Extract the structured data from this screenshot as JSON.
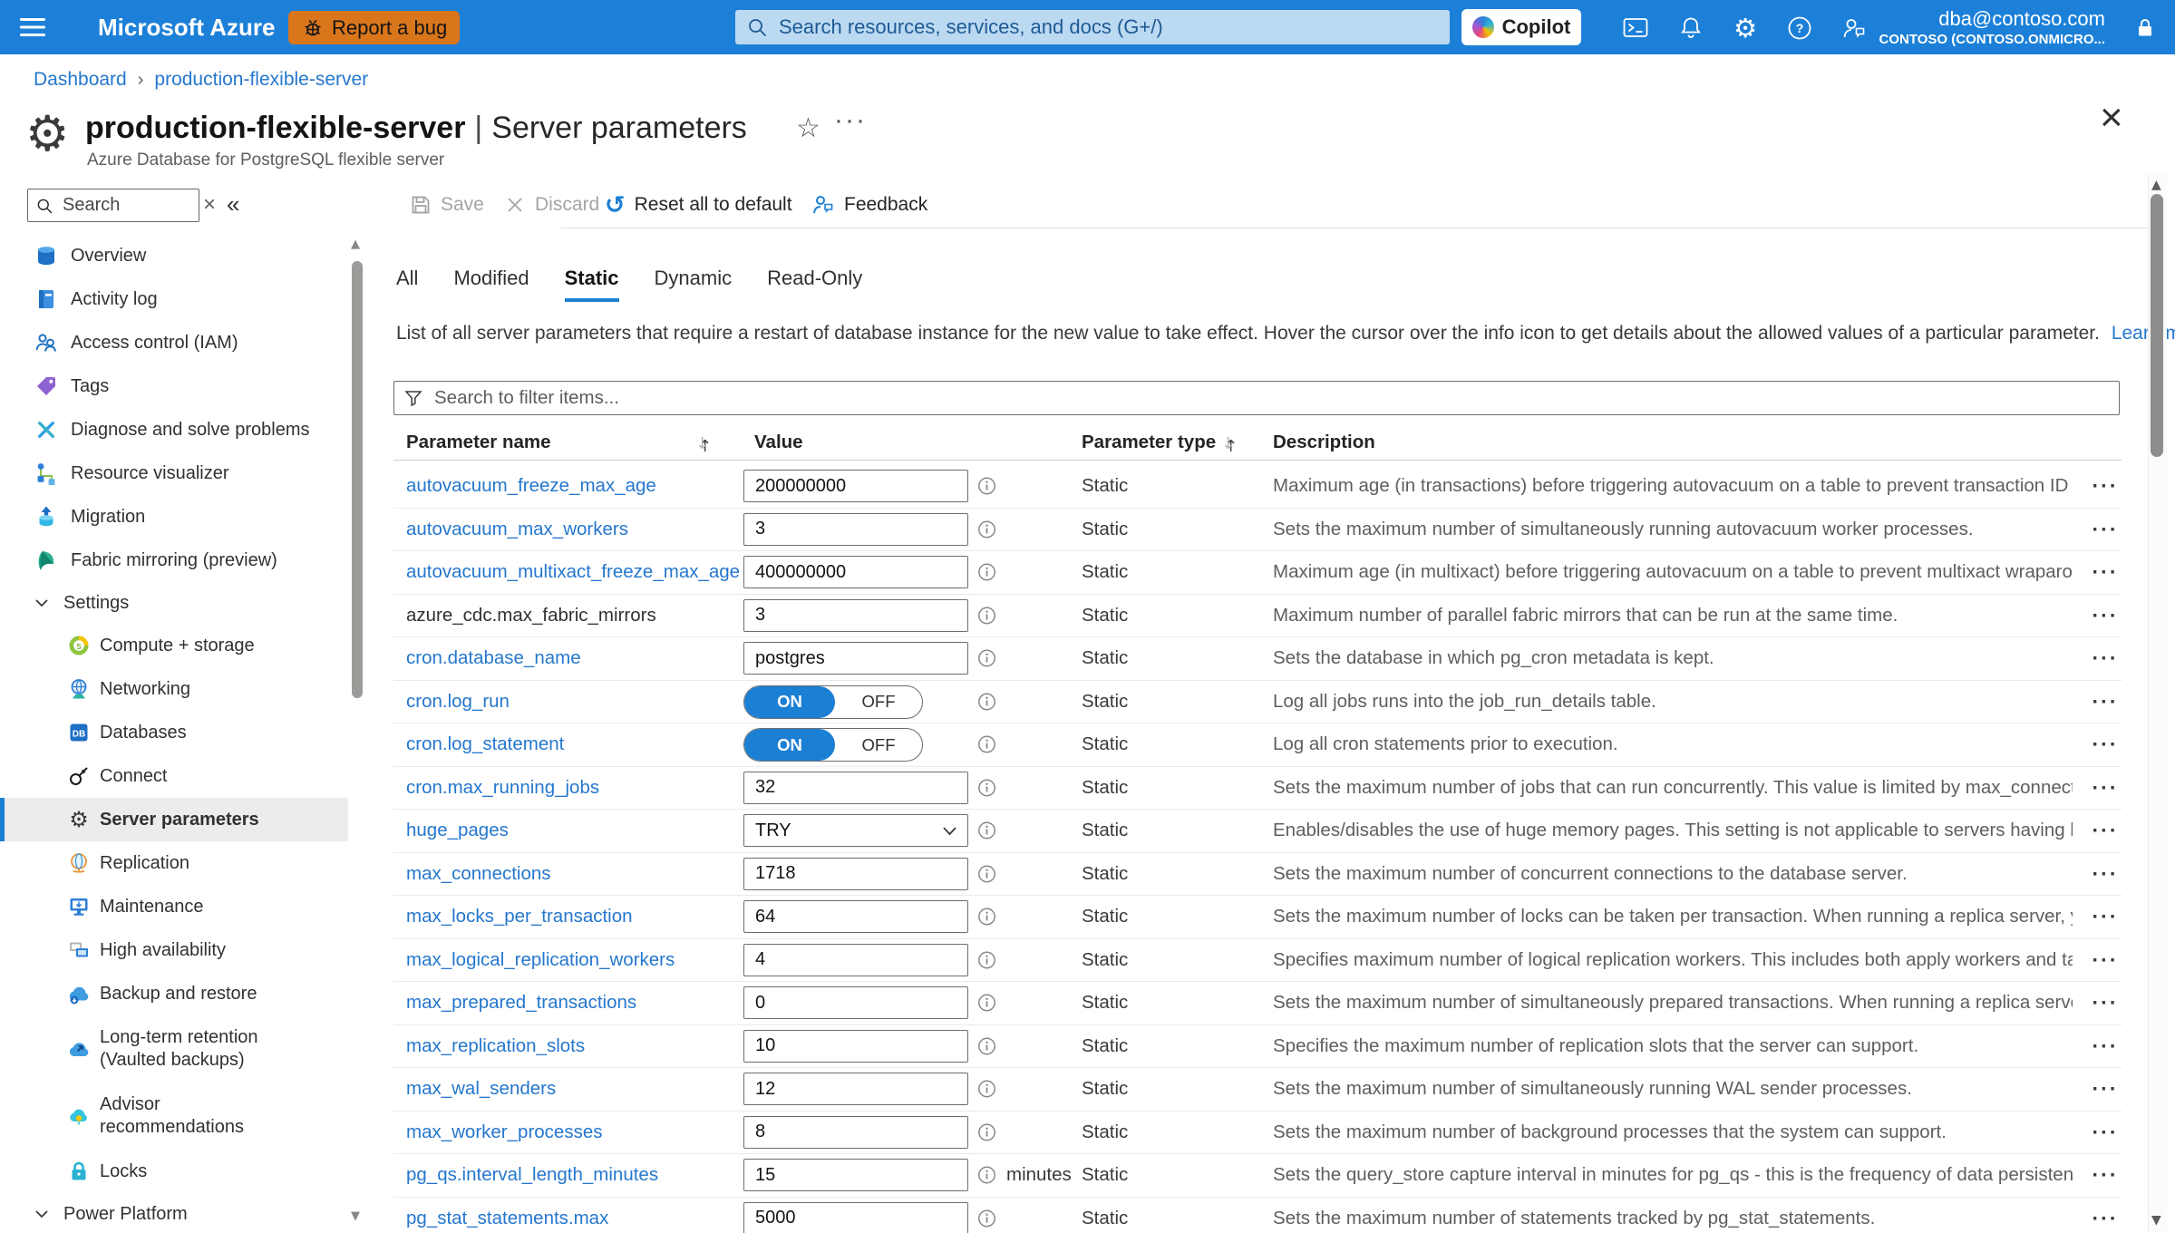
{
  "colors": {
    "topbar_bg": "#1d80d8",
    "accent_blue": "#1b7fd4",
    "report_bug_bg": "#d9761c",
    "link_blue": "#2577cd",
    "selected_item_bg": "#ececec",
    "toggle_on": "#1b7fd4"
  },
  "topbar": {
    "app_name": "Microsoft Azure",
    "report_bug_label": "Report a bug",
    "search_placeholder": "Search resources, services, and docs (G+/)",
    "copilot_label": "Copilot",
    "account_email": "dba@contoso.com",
    "account_tenant": "CONTOSO (CONTOSO.ONMICRO..."
  },
  "breadcrumb": {
    "home": "Dashboard",
    "separator": "›",
    "current": "production-flexible-server"
  },
  "page": {
    "title_name": "production-flexible-server",
    "title_divider": "|",
    "title_section": "Server parameters",
    "subtitle": "Azure Database for PostgreSQL flexible server",
    "star_icon": "☆",
    "more_icon": "···",
    "close_icon": "×"
  },
  "sidebar": {
    "search_placeholder": "Search",
    "clear_icon": "×",
    "collapse_icon": "«",
    "items": [
      {
        "label": "Overview",
        "icon": "overview",
        "kind": "item"
      },
      {
        "label": "Activity log",
        "icon": "activity-log",
        "kind": "item"
      },
      {
        "label": "Access control (IAM)",
        "icon": "access-control",
        "kind": "item"
      },
      {
        "label": "Tags",
        "icon": "tags",
        "kind": "item"
      },
      {
        "label": "Diagnose and solve problems",
        "icon": "diagnose",
        "kind": "item"
      },
      {
        "label": "Resource visualizer",
        "icon": "resource-visualizer",
        "kind": "item"
      },
      {
        "label": "Migration",
        "icon": "migration",
        "kind": "item"
      },
      {
        "label": "Fabric mirroring (preview)",
        "icon": "fabric-mirroring",
        "kind": "item"
      },
      {
        "label": "Settings",
        "icon": "chevron-down",
        "kind": "group"
      },
      {
        "label": "Compute + storage",
        "icon": "compute-storage",
        "kind": "child"
      },
      {
        "label": "Networking",
        "icon": "networking",
        "kind": "child"
      },
      {
        "label": "Databases",
        "icon": "databases",
        "kind": "child"
      },
      {
        "label": "Connect",
        "icon": "connect",
        "kind": "child"
      },
      {
        "label": "Server parameters",
        "icon": "server-parameters",
        "kind": "child",
        "selected": true
      },
      {
        "label": "Replication",
        "icon": "replication",
        "kind": "child"
      },
      {
        "label": "Maintenance",
        "icon": "maintenance",
        "kind": "child"
      },
      {
        "label": "High availability",
        "icon": "high-availability",
        "kind": "child"
      },
      {
        "label": "Backup and restore",
        "icon": "backup-restore",
        "kind": "child"
      },
      {
        "label": "Long-term retention",
        "label2": "(Vaulted backups)",
        "icon": "long-term-retention",
        "kind": "child"
      },
      {
        "label": "Advisor",
        "label2": "recommendations",
        "icon": "advisor",
        "kind": "child"
      },
      {
        "label": "Locks",
        "icon": "locks",
        "kind": "child"
      },
      {
        "label": "Power Platform",
        "icon": "chevron-down",
        "kind": "group"
      }
    ]
  },
  "toolbar": {
    "save": "Save",
    "discard": "Discard",
    "reset": "Reset all to default",
    "feedback": "Feedback"
  },
  "tabs": {
    "labels": [
      "All",
      "Modified",
      "Static",
      "Dynamic",
      "Read-Only"
    ],
    "selected": "Static"
  },
  "intro": {
    "text": "List of all server parameters that require a restart of database instance for the new value to take effect. Hover the cursor over the info icon to get details about the allowed values of a particular parameter.",
    "link_label": "Learn more"
  },
  "filter": {
    "placeholder": "Search to filter items..."
  },
  "table": {
    "headers": {
      "name": "Parameter name",
      "value": "Value",
      "type": "Parameter type",
      "description": "Description"
    },
    "toggle_on": "ON",
    "toggle_off": "OFF",
    "row_actions_icon": "···",
    "rows": [
      {
        "name": "autovacuum_freeze_max_age",
        "link": true,
        "control": "input",
        "value": "200000000",
        "type": "Static",
        "description": "Maximum age (in transactions) before triggering autovacuum on a table to prevent transaction ID wra..."
      },
      {
        "name": "autovacuum_max_workers",
        "link": true,
        "control": "input",
        "value": "3",
        "type": "Static",
        "description": "Sets the maximum number of simultaneously running autovacuum worker processes."
      },
      {
        "name": "autovacuum_multixact_freeze_max_age",
        "link": true,
        "control": "input",
        "value": "400000000",
        "type": "Static",
        "description": "Maximum age (in multixact) before triggering autovacuum on a table to prevent multixact wraparound."
      },
      {
        "name": "azure_cdc.max_fabric_mirrors",
        "link": false,
        "control": "input",
        "value": "3",
        "type": "Static",
        "description": "Maximum number of parallel fabric mirrors that can be run at the same time."
      },
      {
        "name": "cron.database_name",
        "link": true,
        "control": "input",
        "value": "postgres",
        "type": "Static",
        "description": "Sets the database in which pg_cron metadata is kept."
      },
      {
        "name": "cron.log_run",
        "link": true,
        "control": "toggle",
        "value": "ON",
        "type": "Static",
        "description": "Log all jobs runs into the job_run_details table."
      },
      {
        "name": "cron.log_statement",
        "link": true,
        "control": "toggle",
        "value": "ON",
        "type": "Static",
        "description": "Log all cron statements prior to execution."
      },
      {
        "name": "cron.max_running_jobs",
        "link": true,
        "control": "input",
        "value": "32",
        "type": "Static",
        "description": "Sets the maximum number of jobs that can run concurrently. This value is limited by max_connections."
      },
      {
        "name": "huge_pages",
        "link": true,
        "control": "select",
        "value": "TRY",
        "type": "Static",
        "description": "Enables/disables the use of huge memory pages. This setting is not applicable to servers having less t..."
      },
      {
        "name": "max_connections",
        "link": true,
        "control": "input",
        "value": "1718",
        "type": "Static",
        "description": "Sets the maximum number of concurrent connections to the database server."
      },
      {
        "name": "max_locks_per_transaction",
        "link": true,
        "control": "input",
        "value": "64",
        "type": "Static",
        "description": "Sets the maximum number of locks can be taken per transaction. When running a replica server, you ..."
      },
      {
        "name": "max_logical_replication_workers",
        "link": true,
        "control": "input",
        "value": "4",
        "type": "Static",
        "description": "Specifies maximum number of logical replication workers. This includes both apply workers and table ..."
      },
      {
        "name": "max_prepared_transactions",
        "link": true,
        "control": "input",
        "value": "0",
        "type": "Static",
        "description": "Sets the maximum number of simultaneously prepared transactions. When running a replica server, y..."
      },
      {
        "name": "max_replication_slots",
        "link": true,
        "control": "input",
        "value": "10",
        "type": "Static",
        "description": "Specifies the maximum number of replication slots that the server can support."
      },
      {
        "name": "max_wal_senders",
        "link": true,
        "control": "input",
        "value": "12",
        "type": "Static",
        "description": "Sets the maximum number of simultaneously running WAL sender processes."
      },
      {
        "name": "max_worker_processes",
        "link": true,
        "control": "input",
        "value": "8",
        "type": "Static",
        "description": "Sets the maximum number of background processes that the system can support."
      },
      {
        "name": "pg_qs.interval_length_minutes",
        "link": true,
        "control": "input",
        "value": "15",
        "unit": "minutes",
        "type": "Static",
        "description": "Sets the query_store capture interval in minutes for pg_qs - this is the frequency of data persistence."
      },
      {
        "name": "pg_stat_statements.max",
        "link": true,
        "control": "input",
        "value": "5000",
        "type": "Static",
        "description": "Sets the maximum number of statements tracked by pg_stat_statements."
      }
    ]
  }
}
